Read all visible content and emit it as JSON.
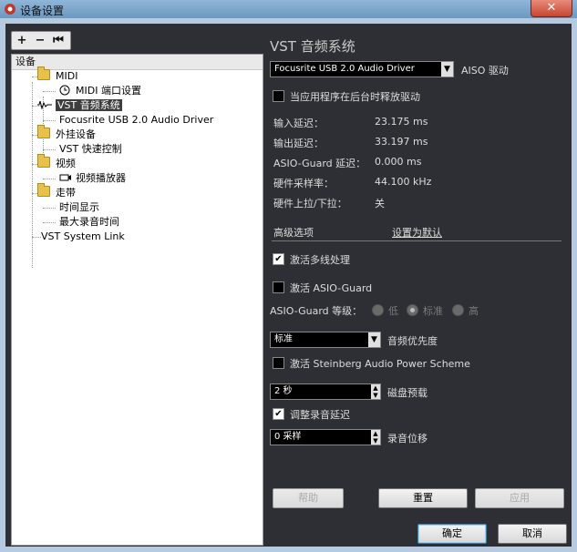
{
  "window": {
    "title": "设备设置",
    "close_glyph": "✕"
  },
  "toolbar": {
    "add": "+",
    "remove": "−",
    "reset": "⏮"
  },
  "left": {
    "header": "设备",
    "tree": [
      {
        "label": "MIDI",
        "type": "folder"
      },
      {
        "label": "MIDI 端口设置",
        "type": "item",
        "icon": "clock-icon"
      },
      {
        "label": "VST 音频系统",
        "type": "item",
        "icon": "audio-icon",
        "selected": true
      },
      {
        "label": "Focusrite USB 2.0 Audio Driver",
        "type": "item"
      },
      {
        "label": "外挂设备",
        "type": "folder"
      },
      {
        "label": "VST 快速控制",
        "type": "item"
      },
      {
        "label": "视频",
        "type": "folder"
      },
      {
        "label": "视频播放器",
        "type": "item",
        "icon": "video-icon"
      },
      {
        "label": "走带",
        "type": "folder"
      },
      {
        "label": "时间显示",
        "type": "item"
      },
      {
        "label": "最大录音时间",
        "type": "item"
      },
      {
        "label": "VST System Link",
        "type": "item"
      }
    ]
  },
  "right": {
    "section_title": "VST 音频系统",
    "driver_select": {
      "value": "Focusrite USB 2.0 Audio Driver"
    },
    "asio_label": "AISO 驱动",
    "release_driver": {
      "label": "当应用程序在后台时释放驱动",
      "checked": false
    },
    "info": [
      {
        "label": "输入延迟：",
        "value": "23.175 ms"
      },
      {
        "label": "输出延迟：",
        "value": "33.197 ms"
      },
      {
        "label": "ASIO-Guard 延迟：",
        "value": "0.000 ms"
      },
      {
        "label": "硬件采样率：",
        "value": "44.100 kHz"
      },
      {
        "label": "硬件上拉/下拉：",
        "value": "关"
      }
    ],
    "advanced_label": "高级选项",
    "set_default_label": "设置为默认",
    "multithread": {
      "label": "激活多线处理",
      "checked": true
    },
    "asio_guard": {
      "label": "激活 ASIO-Guard",
      "checked": false
    },
    "asio_guard_level": {
      "label": "ASIO-Guard 等级：",
      "options": [
        "低",
        "标准",
        "高"
      ],
      "selected": "标准"
    },
    "audio_priority": {
      "value": "标准",
      "label": "音频优先度"
    },
    "power_scheme": {
      "label": "激活 Steinberg Audio Power Scheme",
      "checked": false
    },
    "disk_preload": {
      "value": "2 秒",
      "label": "磁盘预载"
    },
    "adjust_latency": {
      "label": "调整录音延迟",
      "checked": true
    },
    "record_shift": {
      "value": "0 采样",
      "label": "录音位移"
    },
    "buttons": {
      "help": "帮助",
      "reset": "重置",
      "apply": "应用"
    }
  },
  "footer": {
    "ok": "确定",
    "cancel": "取消"
  }
}
